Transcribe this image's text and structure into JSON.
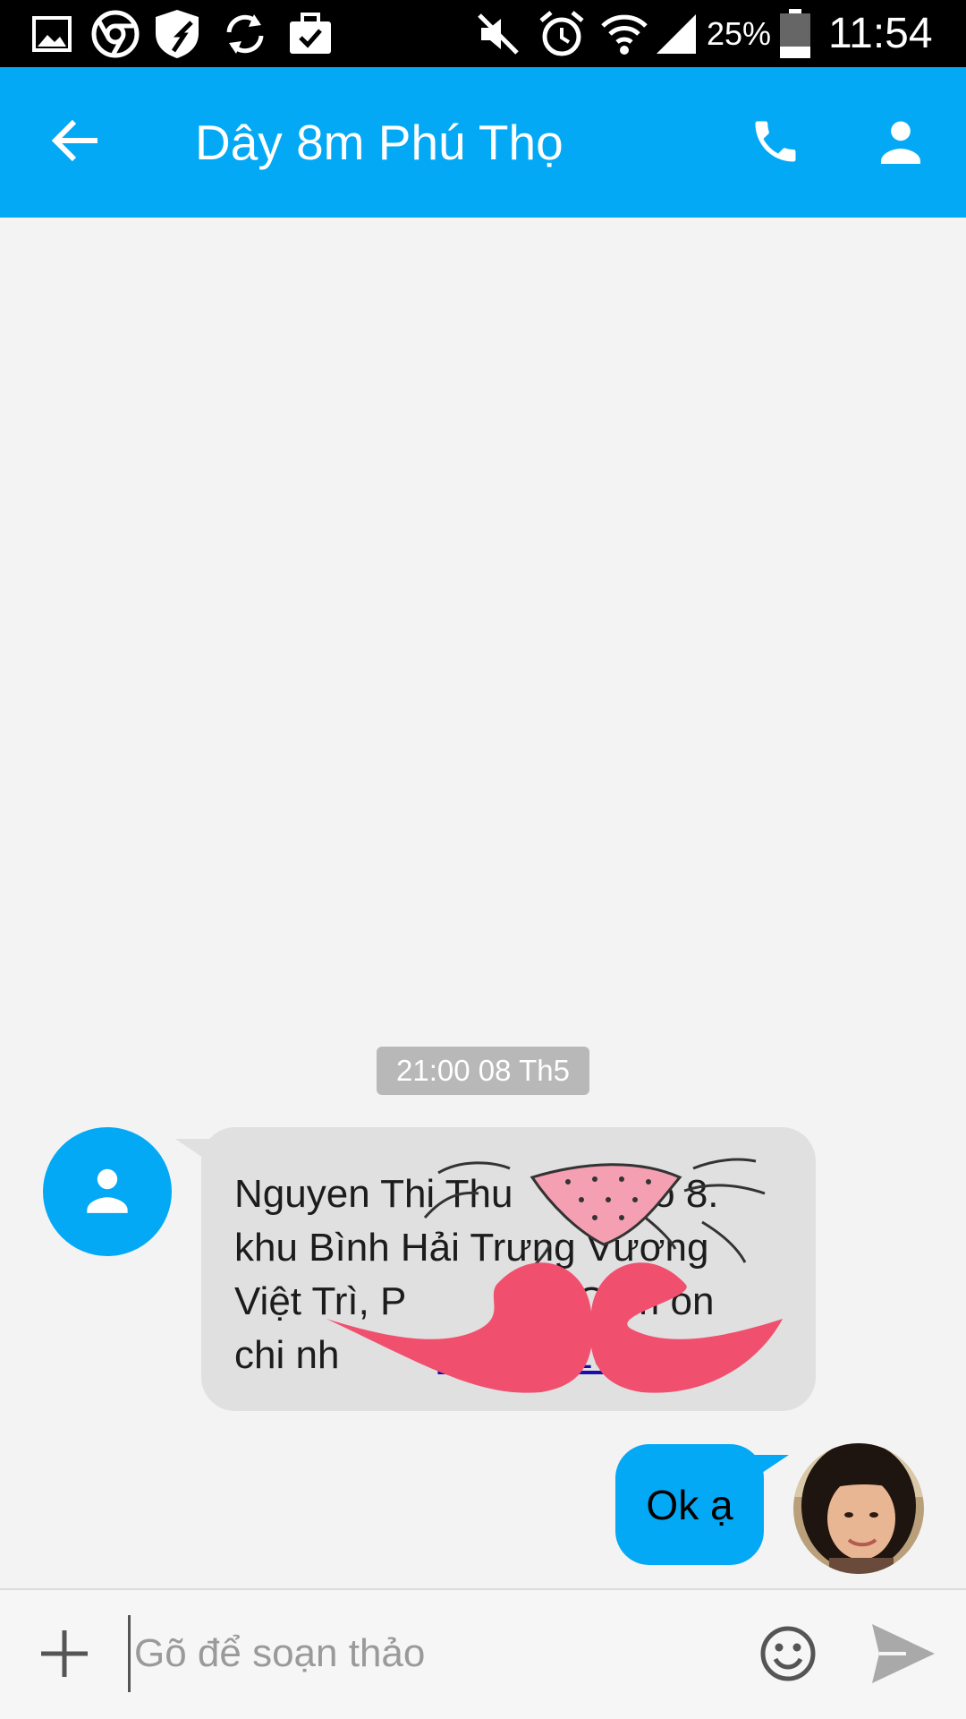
{
  "status_bar": {
    "battery_percent": "25%",
    "time": "11:54",
    "icons": [
      "image-icon",
      "chrome-icon",
      "shield-icon",
      "sync-icon",
      "briefcase-check-icon",
      "mute-icon",
      "alarm-icon",
      "wifi-icon",
      "signal-icon",
      "battery-icon"
    ]
  },
  "app_bar": {
    "title": "Dây 8m Phú Thọ",
    "icons": [
      "back-arrow-icon",
      "phone-icon",
      "contact-icon"
    ]
  },
  "conversation": {
    "timestamp": "21:00 08 Th5",
    "incoming": {
      "line1": "Nguyen Thi Thu",
      "line1_end": ", tổ 8.",
      "line2": "khu Bình Hải Trưng Vương",
      "line3_start": "Việt Trì, P",
      "line3_end": "Cam on",
      "line4_start": "chi nh",
      "phone_fragment_a": "94",
      "phone_fragment_b": "208"
    },
    "outgoing": {
      "text": "Ok ạ"
    }
  },
  "composer": {
    "placeholder": "Gõ để soạn thảo",
    "value": "",
    "icons": [
      "add-icon",
      "emoji-icon",
      "send-icon"
    ]
  },
  "colors": {
    "accent": "#03a9f4",
    "status_bar": "#000000",
    "incoming_bubble": "#e0e0e0",
    "outgoing_bubble": "#03a9f4",
    "background": "#f3f3f4",
    "sticker": "#f0506e"
  }
}
